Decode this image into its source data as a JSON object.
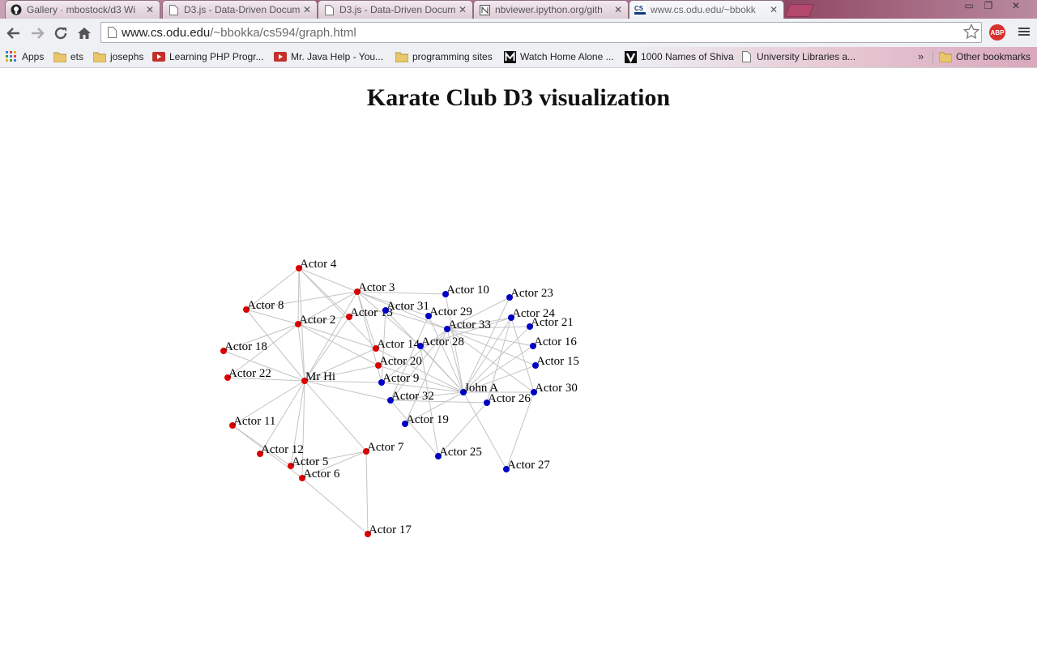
{
  "browser": {
    "tabs": [
      {
        "title": "Gallery · mbostock/d3 Wi",
        "icon": "github-icon"
      },
      {
        "title": "D3.js - Data-Driven Docum",
        "icon": "document-icon"
      },
      {
        "title": "D3.js - Data-Driven Docum",
        "icon": "document-icon"
      },
      {
        "title": "nbviewer.ipython.org/gith",
        "icon": "nbviewer-icon"
      },
      {
        "title": "www.cs.odu.edu/~bbokk",
        "icon": "cs-icon",
        "active": true
      }
    ],
    "address": {
      "host": "www.cs.odu.edu",
      "path": "/~bbokka/cs594/graph.html"
    },
    "extension_label": "ABP",
    "bookmarks": [
      {
        "label": "Apps",
        "icon": "apps-grid-icon"
      },
      {
        "label": "ets",
        "icon": "folder-icon"
      },
      {
        "label": "josephs",
        "icon": "folder-icon"
      },
      {
        "label": "Learning PHP Progr...",
        "icon": "youtube-icon"
      },
      {
        "label": "Mr. Java Help - You...",
        "icon": "youtube-icon"
      },
      {
        "label": "programming sites",
        "icon": "folder-icon"
      },
      {
        "label": "Watch Home Alone ...",
        "icon": "m-logo-icon"
      },
      {
        "label": "1000 Names of Shiva",
        "icon": "v-logo-icon"
      },
      {
        "label": "University Libraries a...",
        "icon": "document-icon"
      }
    ],
    "other_bookmarks": "Other bookmarks",
    "overflow_chevron": "»"
  },
  "page": {
    "title": "Karate Club D3 visualization"
  },
  "graph": {
    "colors": {
      "group1": "#dd0000",
      "group2": "#0000cc",
      "edge": "#c4c4c4"
    },
    "nodes": [
      {
        "id": "MrHi",
        "label": "Mr Hi",
        "group": 1
      },
      {
        "id": "A2",
        "label": "Actor 2",
        "group": 1
      },
      {
        "id": "A3",
        "label": "Actor 3",
        "group": 1
      },
      {
        "id": "A4",
        "label": "Actor 4",
        "group": 1
      },
      {
        "id": "A5",
        "label": "Actor 5",
        "group": 1
      },
      {
        "id": "A6",
        "label": "Actor 6",
        "group": 1
      },
      {
        "id": "A7",
        "label": "Actor 7",
        "group": 1
      },
      {
        "id": "A8",
        "label": "Actor 8",
        "group": 1
      },
      {
        "id": "A9",
        "label": "Actor 9",
        "group": 2
      },
      {
        "id": "A10",
        "label": "Actor 10",
        "group": 2
      },
      {
        "id": "A11",
        "label": "Actor 11",
        "group": 1
      },
      {
        "id": "A12",
        "label": "Actor 12",
        "group": 1
      },
      {
        "id": "A13",
        "label": "Actor 13",
        "group": 1
      },
      {
        "id": "A14",
        "label": "Actor 14",
        "group": 1
      },
      {
        "id": "A15",
        "label": "Actor 15",
        "group": 2
      },
      {
        "id": "A16",
        "label": "Actor 16",
        "group": 2
      },
      {
        "id": "A17",
        "label": "Actor 17",
        "group": 1
      },
      {
        "id": "A18",
        "label": "Actor 18",
        "group": 1
      },
      {
        "id": "A19",
        "label": "Actor 19",
        "group": 2
      },
      {
        "id": "A20",
        "label": "Actor 20",
        "group": 1
      },
      {
        "id": "A21",
        "label": "Actor 21",
        "group": 2
      },
      {
        "id": "A22",
        "label": "Actor 22",
        "group": 1
      },
      {
        "id": "A23",
        "label": "Actor 23",
        "group": 2
      },
      {
        "id": "A24",
        "label": "Actor 24",
        "group": 2
      },
      {
        "id": "A25",
        "label": "Actor 25",
        "group": 2
      },
      {
        "id": "A26",
        "label": "Actor 26",
        "group": 2
      },
      {
        "id": "A27",
        "label": "Actor 27",
        "group": 2
      },
      {
        "id": "A28",
        "label": "Actor 28",
        "group": 2
      },
      {
        "id": "A29",
        "label": "Actor 29",
        "group": 2
      },
      {
        "id": "A30",
        "label": "Actor 30",
        "group": 2
      },
      {
        "id": "A31",
        "label": "Actor 31",
        "group": 2
      },
      {
        "id": "A32",
        "label": "Actor 32",
        "group": 2
      },
      {
        "id": "A33",
        "label": "Actor 33",
        "group": 2
      },
      {
        "id": "JohnA",
        "label": "John A",
        "group": 2
      }
    ],
    "links": [
      [
        "MrHi",
        "A2"
      ],
      [
        "MrHi",
        "A3"
      ],
      [
        "MrHi",
        "A4"
      ],
      [
        "MrHi",
        "A5"
      ],
      [
        "MrHi",
        "A6"
      ],
      [
        "MrHi",
        "A7"
      ],
      [
        "MrHi",
        "A8"
      ],
      [
        "MrHi",
        "A9"
      ],
      [
        "MrHi",
        "A11"
      ],
      [
        "MrHi",
        "A12"
      ],
      [
        "MrHi",
        "A13"
      ],
      [
        "MrHi",
        "A14"
      ],
      [
        "MrHi",
        "A18"
      ],
      [
        "MrHi",
        "A20"
      ],
      [
        "MrHi",
        "A22"
      ],
      [
        "MrHi",
        "A32"
      ],
      [
        "A2",
        "A3"
      ],
      [
        "A2",
        "A4"
      ],
      [
        "A2",
        "A8"
      ],
      [
        "A2",
        "A14"
      ],
      [
        "A2",
        "A18"
      ],
      [
        "A2",
        "A20"
      ],
      [
        "A2",
        "A22"
      ],
      [
        "A2",
        "A31"
      ],
      [
        "A3",
        "A4"
      ],
      [
        "A3",
        "A8"
      ],
      [
        "A3",
        "A9"
      ],
      [
        "A3",
        "A10"
      ],
      [
        "A3",
        "A14"
      ],
      [
        "A3",
        "A28"
      ],
      [
        "A3",
        "A29"
      ],
      [
        "A3",
        "A33"
      ],
      [
        "A4",
        "A8"
      ],
      [
        "A4",
        "A13"
      ],
      [
        "A4",
        "A14"
      ],
      [
        "A5",
        "A7"
      ],
      [
        "A5",
        "A11"
      ],
      [
        "A6",
        "A7"
      ],
      [
        "A6",
        "A11"
      ],
      [
        "A6",
        "A17"
      ],
      [
        "A7",
        "A17"
      ],
      [
        "A9",
        "A31"
      ],
      [
        "A9",
        "A33"
      ],
      [
        "A9",
        "JohnA"
      ],
      [
        "A10",
        "JohnA"
      ],
      [
        "A14",
        "JohnA"
      ],
      [
        "A15",
        "A33"
      ],
      [
        "A15",
        "JohnA"
      ],
      [
        "A16",
        "A33"
      ],
      [
        "A16",
        "JohnA"
      ],
      [
        "A19",
        "A33"
      ],
      [
        "A19",
        "JohnA"
      ],
      [
        "A20",
        "JohnA"
      ],
      [
        "A21",
        "A33"
      ],
      [
        "A21",
        "JohnA"
      ],
      [
        "A23",
        "A33"
      ],
      [
        "A23",
        "JohnA"
      ],
      [
        "A24",
        "A26"
      ],
      [
        "A24",
        "A28"
      ],
      [
        "A24",
        "A30"
      ],
      [
        "A24",
        "A33"
      ],
      [
        "A24",
        "JohnA"
      ],
      [
        "A25",
        "A26"
      ],
      [
        "A25",
        "A28"
      ],
      [
        "A25",
        "A32"
      ],
      [
        "A26",
        "A32"
      ],
      [
        "A27",
        "A30"
      ],
      [
        "A27",
        "JohnA"
      ],
      [
        "A28",
        "JohnA"
      ],
      [
        "A29",
        "A32"
      ],
      [
        "A29",
        "JohnA"
      ],
      [
        "A30",
        "A33"
      ],
      [
        "A30",
        "JohnA"
      ],
      [
        "A31",
        "A33"
      ],
      [
        "A31",
        "JohnA"
      ],
      [
        "A32",
        "A33"
      ],
      [
        "A32",
        "JohnA"
      ],
      [
        "A33",
        "JohnA"
      ]
    ]
  }
}
